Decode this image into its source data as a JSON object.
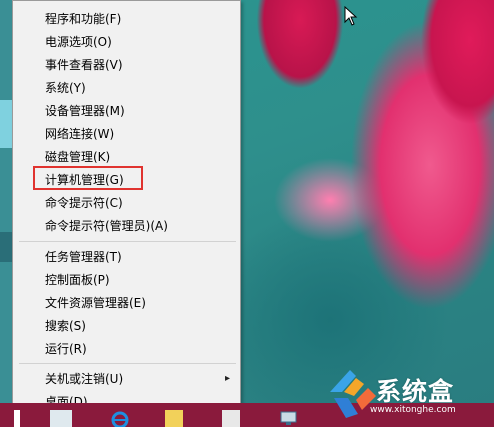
{
  "menu": {
    "items": [
      {
        "label": "程序和功能(F)"
      },
      {
        "label": "电源选项(O)"
      },
      {
        "label": "事件查看器(V)"
      },
      {
        "label": "系统(Y)"
      },
      {
        "label": "设备管理器(M)"
      },
      {
        "label": "网络连接(W)"
      },
      {
        "label": "磁盘管理(K)"
      },
      {
        "label": "计算机管理(G)"
      },
      {
        "label": "命令提示符(C)"
      },
      {
        "label": "命令提示符(管理员)(A)"
      },
      {
        "label": "任务管理器(T)"
      },
      {
        "label": "控制面板(P)"
      },
      {
        "label": "文件资源管理器(E)"
      },
      {
        "label": "搜索(S)"
      },
      {
        "label": "运行(R)"
      },
      {
        "label": "关机或注销(U)",
        "submenu_icon": "chevron-right-icon"
      },
      {
        "label": "桌面(D)"
      }
    ],
    "highlighted": "计算机管理(G)"
  },
  "watermark": {
    "brand": "系统盒",
    "url": "www.xitonghe.com"
  },
  "colors": {
    "menu_bg": "#f1f1f1",
    "highlight_border": "#e0332f",
    "taskbar": "#8a1a3c"
  }
}
